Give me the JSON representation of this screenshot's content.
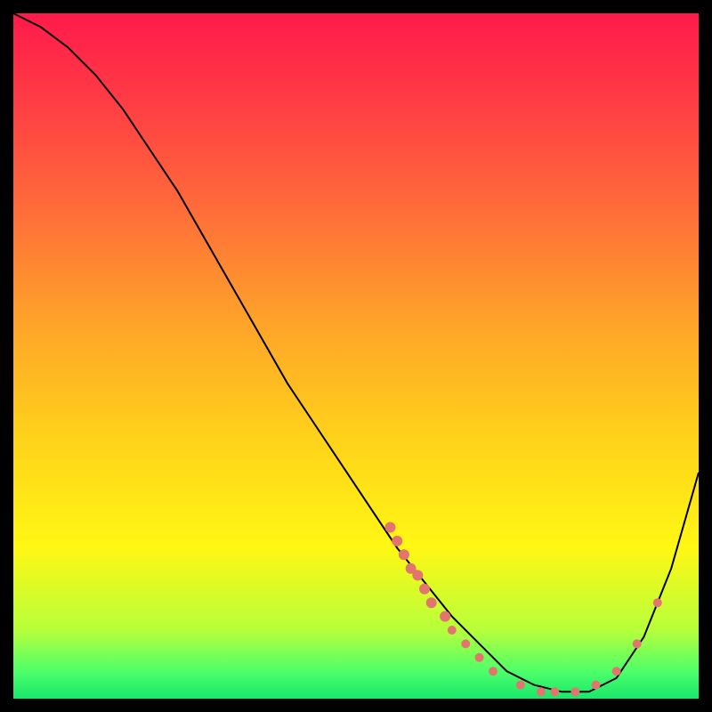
{
  "watermark": "TheBottleneck.com",
  "chart_data": {
    "type": "line",
    "title": "",
    "xlabel": "",
    "ylabel": "",
    "xlim": [
      0,
      100
    ],
    "ylim": [
      0,
      100
    ],
    "grid": false,
    "series": [
      {
        "name": "curve",
        "x": [
          0,
          4,
          8,
          12,
          16,
          20,
          24,
          28,
          32,
          36,
          40,
          44,
          48,
          52,
          56,
          60,
          64,
          68,
          72,
          76,
          80,
          84,
          88,
          92,
          96,
          100
        ],
        "y": [
          100,
          98,
          95,
          91,
          86,
          80,
          74,
          67,
          60,
          53,
          46,
          40,
          34,
          28,
          22,
          17,
          12,
          8,
          4,
          2,
          1,
          1,
          3,
          9,
          19,
          33
        ],
        "stroke": "#000000",
        "width": 2
      }
    ],
    "markers": [
      {
        "x": 55,
        "y": 25,
        "r": 6,
        "fill": "#e2766f"
      },
      {
        "x": 56,
        "y": 23,
        "r": 6,
        "fill": "#e2766f"
      },
      {
        "x": 57,
        "y": 21,
        "r": 6,
        "fill": "#e2766f"
      },
      {
        "x": 58,
        "y": 19,
        "r": 6,
        "fill": "#e2766f"
      },
      {
        "x": 59,
        "y": 18,
        "r": 6,
        "fill": "#e2766f"
      },
      {
        "x": 60,
        "y": 16,
        "r": 6,
        "fill": "#e2766f"
      },
      {
        "x": 61,
        "y": 14,
        "r": 6,
        "fill": "#e2766f"
      },
      {
        "x": 63,
        "y": 12,
        "r": 6,
        "fill": "#e2766f"
      },
      {
        "x": 64,
        "y": 10,
        "r": 5,
        "fill": "#e2766f"
      },
      {
        "x": 66,
        "y": 8,
        "r": 5,
        "fill": "#e2766f"
      },
      {
        "x": 68,
        "y": 6,
        "r": 5,
        "fill": "#e2766f"
      },
      {
        "x": 70,
        "y": 4,
        "r": 5,
        "fill": "#e2766f"
      },
      {
        "x": 74,
        "y": 2,
        "r": 5,
        "fill": "#e2766f"
      },
      {
        "x": 77,
        "y": 1,
        "r": 5,
        "fill": "#e2766f"
      },
      {
        "x": 79,
        "y": 1,
        "r": 5,
        "fill": "#e2766f"
      },
      {
        "x": 82,
        "y": 1,
        "r": 5,
        "fill": "#e2766f"
      },
      {
        "x": 85,
        "y": 2,
        "r": 5,
        "fill": "#e2766f"
      },
      {
        "x": 88,
        "y": 4,
        "r": 5,
        "fill": "#e2766f"
      },
      {
        "x": 91,
        "y": 8,
        "r": 5,
        "fill": "#e2766f"
      },
      {
        "x": 94,
        "y": 14,
        "r": 5,
        "fill": "#e2766f"
      }
    ],
    "gradient_stops": [
      {
        "offset": 0.0,
        "color": "#ff1a4b"
      },
      {
        "offset": 0.12,
        "color": "#ff3a45"
      },
      {
        "offset": 0.28,
        "color": "#ff6a3a"
      },
      {
        "offset": 0.45,
        "color": "#ffa329"
      },
      {
        "offset": 0.62,
        "color": "#ffd21a"
      },
      {
        "offset": 0.78,
        "color": "#fff714"
      },
      {
        "offset": 0.9,
        "color": "#b7ff3a"
      },
      {
        "offset": 0.96,
        "color": "#4eff6a"
      },
      {
        "offset": 1.0,
        "color": "#18e86a"
      }
    ]
  }
}
